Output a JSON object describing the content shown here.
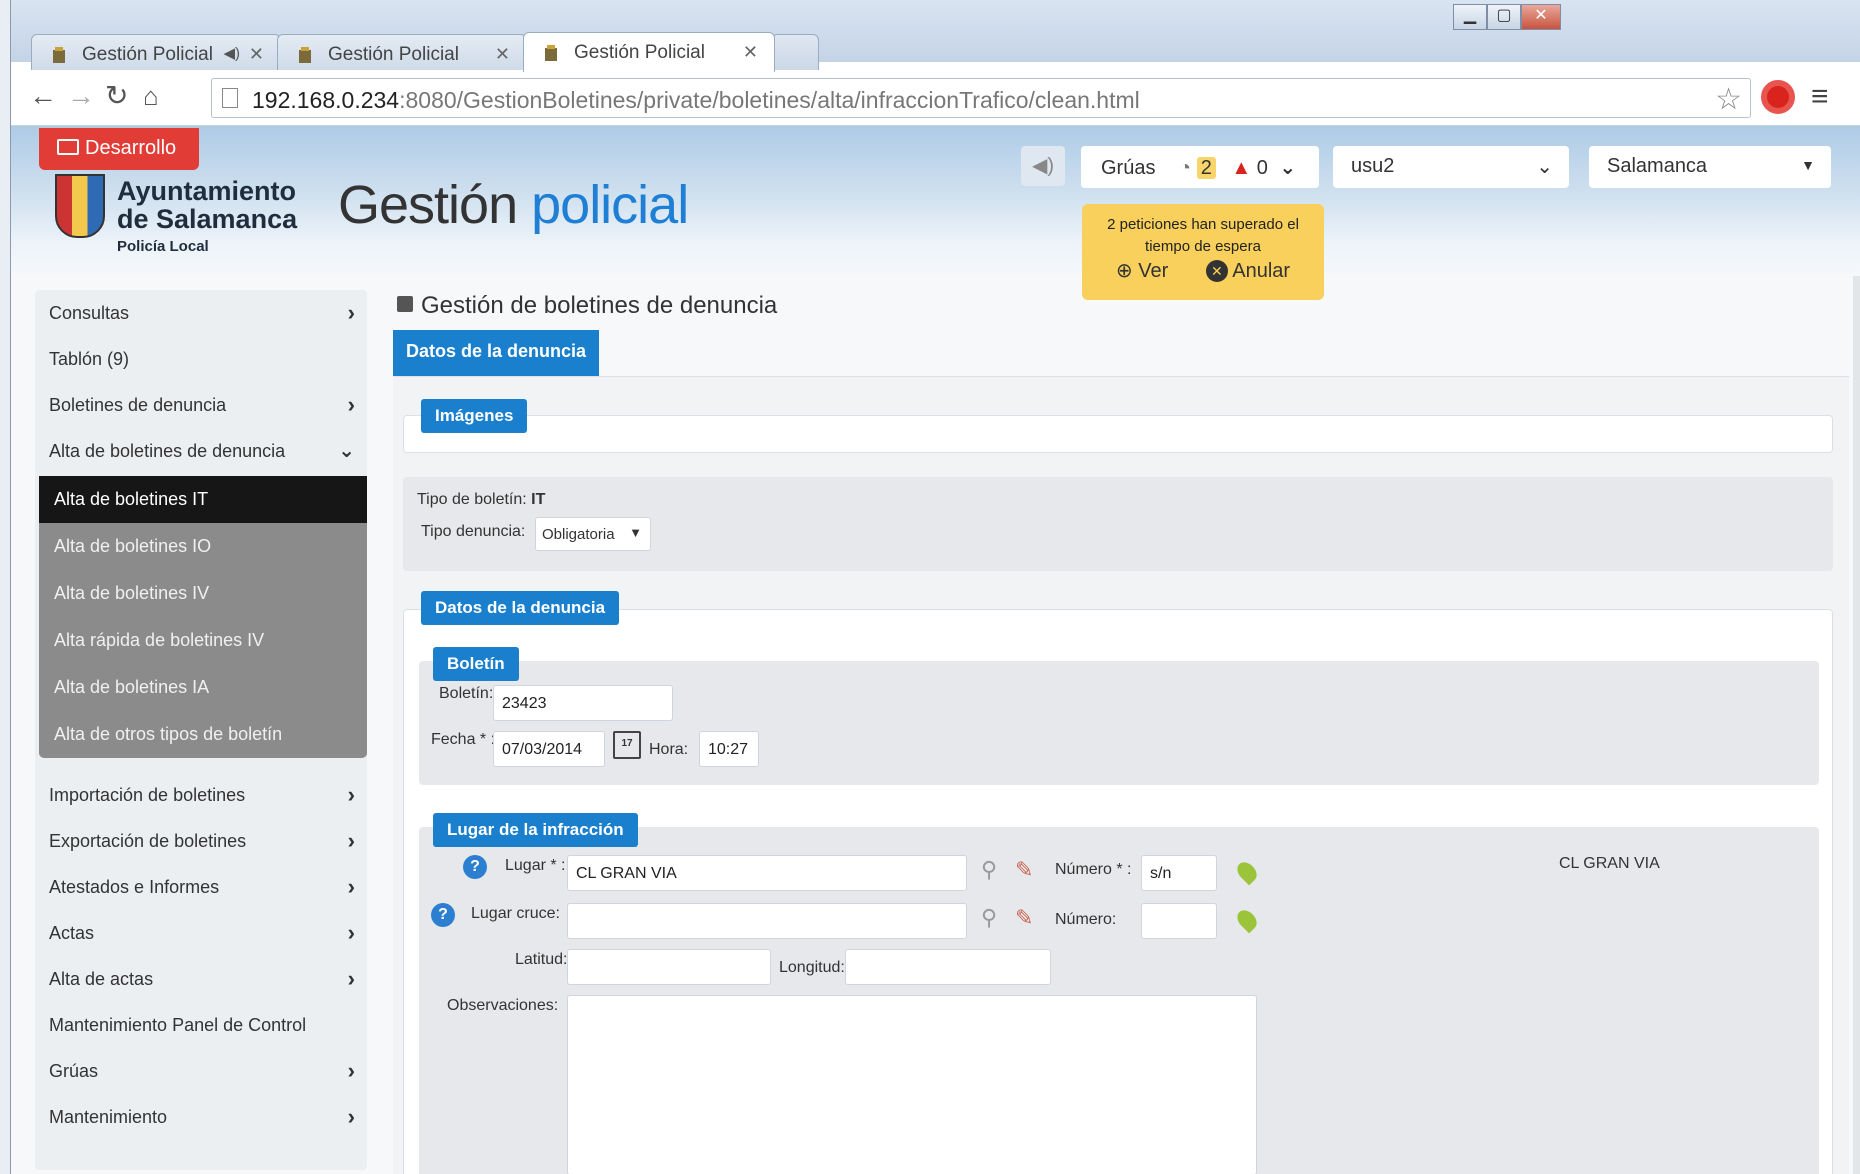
{
  "browser": {
    "tabs": [
      {
        "label": "Gestión Policial"
      },
      {
        "label": "Gestión Policial"
      },
      {
        "label": "Gestión Policial"
      }
    ],
    "url_host": "192.168.0.234",
    "url_rest": ":8080/GestionBoletines/private/boletines/alta/infraccionTrafico/clean.html"
  },
  "header": {
    "env_badge": "Desarrollo",
    "logo_line1": "Ayuntamiento",
    "logo_line2": "de Salamanca",
    "logo_line3": "Policía Local",
    "title_part1": "Gestión",
    "title_part2": "policial",
    "gruas_label": "Grúas",
    "gruas_pending": "2",
    "gruas_alerts": "0",
    "user": "usu2",
    "city": "Salamanca",
    "alert_line1": "2 peticiones han superado el",
    "alert_line2": "tiempo de espera",
    "alert_view": "Ver",
    "alert_cancel": "Anular"
  },
  "sidebar": {
    "items": [
      {
        "label": "Consultas"
      },
      {
        "label": "Tablón (9)"
      },
      {
        "label": "Boletines de denuncia"
      },
      {
        "label": "Alta de boletines de denuncia"
      },
      {
        "label": "Importación de boletines"
      },
      {
        "label": "Exportación de boletines"
      },
      {
        "label": "Atestados e Informes"
      },
      {
        "label": "Actas"
      },
      {
        "label": "Alta de actas"
      },
      {
        "label": "Mantenimiento Panel de Control"
      },
      {
        "label": "Grúas"
      },
      {
        "label": "Mantenimiento"
      }
    ],
    "subitems": [
      {
        "label": "Alta de boletines IT"
      },
      {
        "label": "Alta de boletines IO"
      },
      {
        "label": "Alta de boletines IV"
      },
      {
        "label": "Alta rápida de boletines IV"
      },
      {
        "label": "Alta de boletines IA"
      },
      {
        "label": "Alta de otros tipos de boletín"
      }
    ]
  },
  "main": {
    "heading": "Gestión de boletines de denuncia",
    "tab": "Datos de la denuncia",
    "images_section": "Imágenes",
    "tipo_boletin_label": "Tipo de boletín:",
    "tipo_boletin_value": "IT",
    "tipo_denuncia_label": "Tipo denuncia:",
    "tipo_denuncia_value": "Obligatoria",
    "datos_section": "Datos de la denuncia",
    "boletin_section": "Boletín",
    "boletin_label": "Boletín:",
    "boletin_value": "23423",
    "fecha_label": "Fecha * :",
    "fecha_value": "07/03/2014",
    "calendar_day": "17",
    "hora_label": "Hora:",
    "hora_value": "10:27",
    "lugar_section": "Lugar de la infracción",
    "lugar_label": "Lugar * :",
    "lugar_value": "CL GRAN VIA",
    "numero_req_label": "Número * :",
    "numero_value": "s/n",
    "lugar_cruce_label": "Lugar cruce:",
    "lugar_cruce_value": "",
    "numero_label": "Número:",
    "numero2_value": "",
    "latitud_label": "Latitud:",
    "latitud_value": "",
    "longitud_label": "Longitud:",
    "longitud_value": "",
    "observaciones_label": "Observaciones:",
    "location_preview": "CL GRAN VIA"
  }
}
